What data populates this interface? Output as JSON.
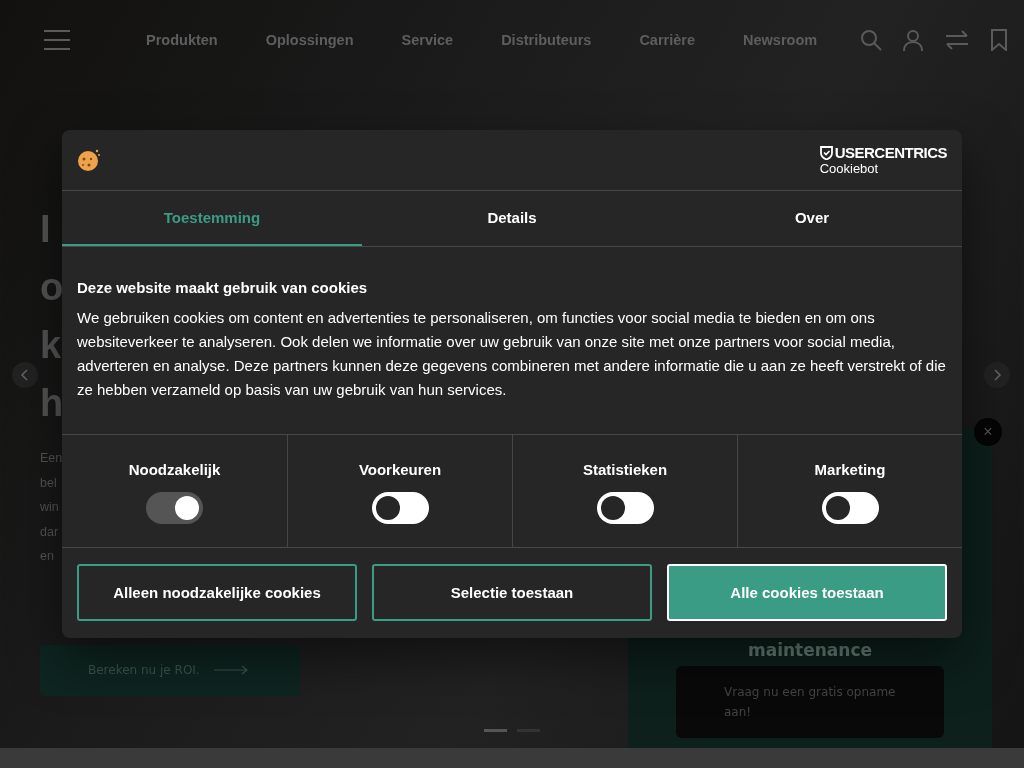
{
  "nav": {
    "links": [
      "Produkten",
      "Oplossingen",
      "Service",
      "Distributeurs",
      "Carrière",
      "Newsroom"
    ]
  },
  "hero": {
    "heading_lines": [
      "I",
      "o",
      "k",
      "h"
    ],
    "paragraph_lines": [
      "Een",
      "bel",
      "win",
      "dar",
      "en"
    ],
    "cta": "Bereken nu je ROI."
  },
  "carousel": {
    "dots": [
      {
        "selected": true
      },
      {
        "selected": false
      }
    ]
  },
  "promo": {
    "title": "maintenance",
    "button": "Vraag nu een gratis opname aan!",
    "close": "×"
  },
  "dialog": {
    "brand": {
      "name": "USERCENTRICS",
      "product": "Cookiebot"
    },
    "tabs": [
      {
        "label": "Toestemming",
        "selected": true
      },
      {
        "label": "Details",
        "selected": false
      },
      {
        "label": "Over",
        "selected": false
      }
    ],
    "heading": "Deze website maakt gebruik van cookies",
    "body": "We gebruiken cookies om content en advertenties te personaliseren, om functies voor social media te bieden en om ons websiteverkeer te analyseren. Ook delen we informatie over uw gebruik van onze site met onze partners voor social media, adverteren en analyse. Deze partners kunnen deze gegevens combineren met andere informatie die u aan ze heeft verstrekt of die ze hebben verzameld op basis van uw gebruik van hun services.",
    "categories": [
      {
        "label": "Noodzakelijk",
        "on": true,
        "disabled": true
      },
      {
        "label": "Voorkeuren",
        "on": false,
        "disabled": false
      },
      {
        "label": "Statistieken",
        "on": false,
        "disabled": false
      },
      {
        "label": "Marketing",
        "on": false,
        "disabled": false
      }
    ],
    "buttons": [
      {
        "label": "Alleen noodzakelijke cookies",
        "kind": "outline"
      },
      {
        "label": "Selectie toestaan",
        "kind": "outline"
      },
      {
        "label": "Alle cookies toestaan",
        "kind": "primary"
      }
    ]
  }
}
